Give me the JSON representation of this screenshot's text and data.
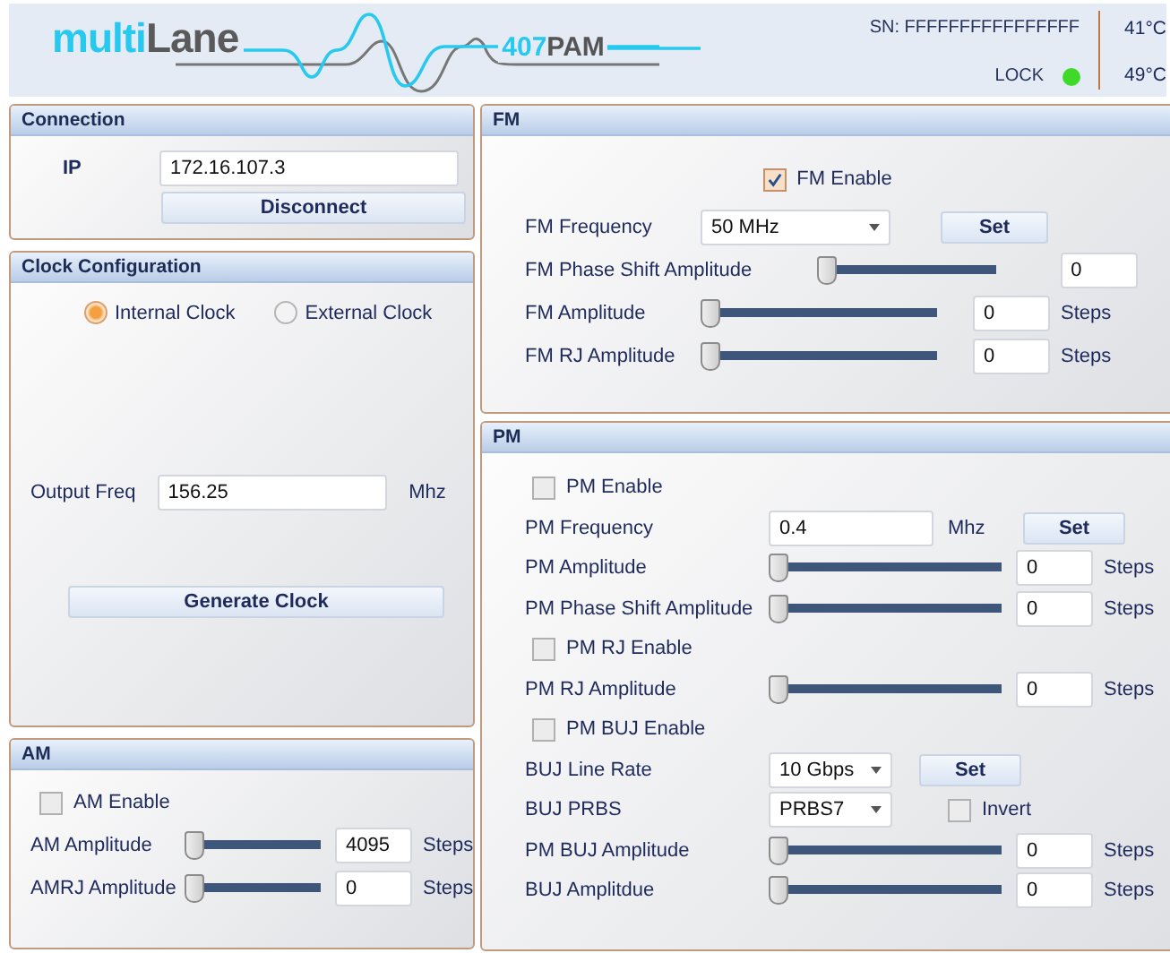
{
  "header": {
    "logo": {
      "part1": "multi",
      "part2": "Lane"
    },
    "product": {
      "number": "407",
      "suffix": "PAM"
    },
    "serial": "SN: FFFFFFFFFFFFFFFF",
    "lock": {
      "label": "LOCK",
      "on": true
    },
    "temperatures": [
      "41°C",
      "49°C"
    ]
  },
  "connection": {
    "title": "Connection",
    "ip_label": "IP",
    "ip_value": "172.16.107.3",
    "button": "Disconnect"
  },
  "clock": {
    "title": "Clock Configuration",
    "radios": [
      {
        "label": "Internal Clock",
        "selected": true
      },
      {
        "label": "External Clock",
        "selected": false
      }
    ],
    "output_label": "Output Freq",
    "output_value": "156.25",
    "output_unit": "Mhz",
    "button": "Generate Clock"
  },
  "am": {
    "title": "AM",
    "rows": [
      {
        "kind": "checkbox",
        "label": "AM Enable",
        "checked": false
      },
      {
        "kind": "slider",
        "label": "AM Amplitude",
        "level": 0,
        "value": "4095",
        "unit": "Steps"
      },
      {
        "kind": "slider",
        "label": "AMRJ Amplitude",
        "level": 0,
        "value": "0",
        "unit": "Steps"
      }
    ]
  },
  "fm": {
    "title": "FM",
    "rows": [
      {
        "kind": "checkbox",
        "label": "FM Enable",
        "checked": true
      },
      {
        "kind": "dropdown",
        "label": "FM Frequency",
        "value": "50 MHz",
        "button": "Set"
      },
      {
        "kind": "slider",
        "label": "FM Phase Shift Amplitude",
        "level": 0,
        "value": "0"
      },
      {
        "kind": "slider",
        "label": "FM Amplitude",
        "level": 0,
        "value": "0",
        "unit": "Steps"
      },
      {
        "kind": "slider",
        "label": "FM RJ Amplitude",
        "level": 0,
        "value": "0",
        "unit": "Steps"
      }
    ]
  },
  "pm": {
    "title": "PM",
    "rows": [
      {
        "kind": "checkbox",
        "label": "PM Enable",
        "checked": false
      },
      {
        "kind": "input",
        "label": "PM Frequency",
        "value": "0.4",
        "unit": "Mhz",
        "button": "Set"
      },
      {
        "kind": "slider",
        "label": "PM Amplitude",
        "level": 0,
        "value": "0",
        "unit": "Steps"
      },
      {
        "kind": "slider",
        "label": "PM Phase Shift Amplitude",
        "level": 0,
        "value": "0",
        "unit": "Steps"
      },
      {
        "kind": "checkbox",
        "label": "PM RJ Enable",
        "checked": false
      },
      {
        "kind": "slider",
        "label": "PM RJ Amplitude",
        "level": 0,
        "value": "0",
        "unit": "Steps"
      },
      {
        "kind": "checkbox",
        "label": "PM BUJ Enable",
        "checked": false
      },
      {
        "kind": "dropdown",
        "label": "BUJ Line Rate",
        "value": "10 Gbps",
        "button": "Set"
      },
      {
        "kind": "dropdown",
        "label": "BUJ PRBS",
        "value": "PRBS7",
        "option": {
          "label": "Invert",
          "checked": false
        }
      },
      {
        "kind": "slider",
        "label": "PM BUJ Amplitude",
        "level": 0,
        "value": "0",
        "unit": "Steps"
      },
      {
        "kind": "slider",
        "label": "BUJ Amplitdue",
        "level": 0,
        "value": "0",
        "unit": "Steps"
      }
    ]
  }
}
